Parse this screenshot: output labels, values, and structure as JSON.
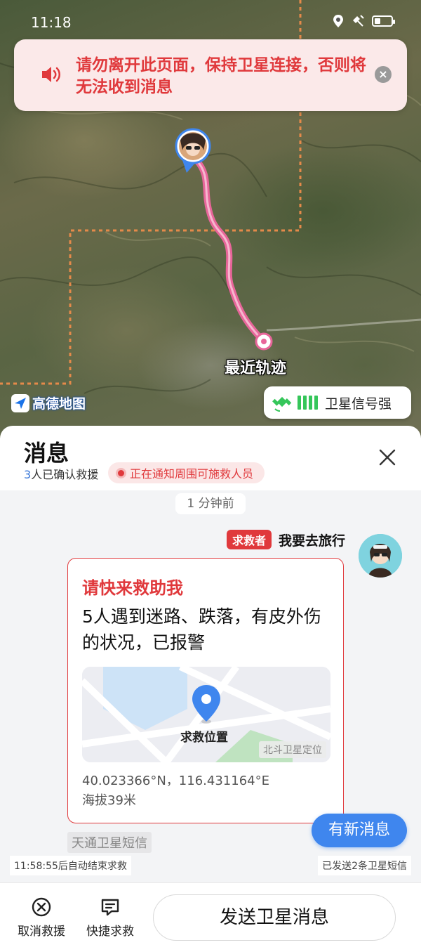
{
  "status_bar": {
    "time": "11:18"
  },
  "banner": {
    "text": "请勿离开此页面，保持卫星连接，否则将无法收到消息",
    "close": "×"
  },
  "map": {
    "track_label": "最近轨迹",
    "provider": "高德地图",
    "signal_text": "卫星信号强",
    "signal_bars": 4
  },
  "sheet": {
    "title": "消息",
    "confirm_count": "3",
    "confirm_suffix": "人已确认救援",
    "notify_text": "正在通知周围可施救人员",
    "close": "×"
  },
  "chat": {
    "timestamp": "1 分钟前",
    "sender_badge": "求救者",
    "sender_name": "我要去旅行",
    "card_title": "请快来救助我",
    "card_body": "5人遇到迷路、跌落，有皮外伤的状况，已报警",
    "location_label": "求救位置",
    "beidou_tag": "北斗卫星定位",
    "coords": "40.023366°N，116.431164°E",
    "altitude": "海拔39米",
    "channel": "天通卫星短信",
    "new_msg": "有新消息",
    "auto_end": "11:58:55后自动结束求救",
    "sent_count": "已发送2条卫星短信"
  },
  "bottom": {
    "cancel_label": "取消救援",
    "quick_label": "快捷求救",
    "send_label": "发送卫星消息"
  },
  "colors": {
    "accent_red": "#e0393c",
    "accent_blue": "#3f86ee",
    "track_pink": "#e8669a",
    "signal_green": "#35c65a"
  }
}
